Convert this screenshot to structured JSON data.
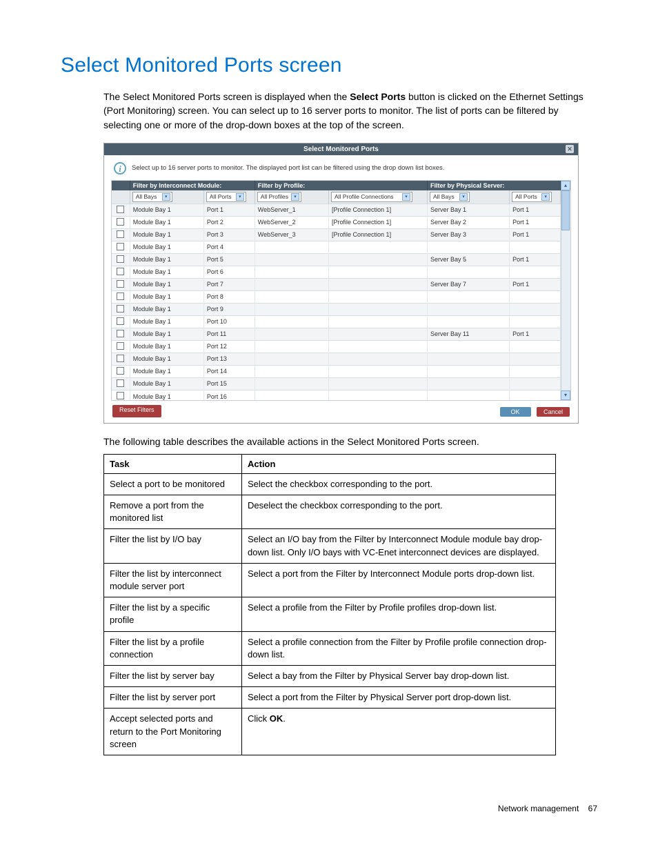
{
  "heading": "Select Monitored Ports screen",
  "intro_before": "The Select Monitored Ports screen is displayed when the ",
  "intro_bold": "Select Ports",
  "intro_after": " button is clicked on the Ethernet Settings (Port Monitoring) screen. You can select up to 16 server ports to monitor. The list of ports can be filtered by selecting one or more of the drop-down boxes at the top of the screen.",
  "dialog": {
    "title": "Select Monitored Ports",
    "info": "Select up to 16 server ports to monitor. The displayed port list can be filtered using the drop down list boxes.",
    "group_headers": {
      "interconnect": "Filter by Interconnect Module:",
      "profile": "Filter by Profile:",
      "server": "Filter by Physical Server:"
    },
    "filters": {
      "bays": "All Bays",
      "ports": "All Ports",
      "profiles": "All Profiles",
      "profile_conn": "All Profile Connections",
      "srv_bays": "All Bays",
      "srv_ports": "All Ports"
    },
    "rows": [
      {
        "module": "Module Bay 1",
        "port": "Port 1",
        "profile": "WebServer_1",
        "conn": "[Profile Connection 1]",
        "srv_bay": "Server Bay 1",
        "srv_port": "Port 1"
      },
      {
        "module": "Module Bay 1",
        "port": "Port 2",
        "profile": "WebServer_2",
        "conn": "[Profile Connection 1]",
        "srv_bay": "Server Bay 2",
        "srv_port": "Port 1"
      },
      {
        "module": "Module Bay 1",
        "port": "Port 3",
        "profile": "WebServer_3",
        "conn": "[Profile Connection 1]",
        "srv_bay": "Server Bay 3",
        "srv_port": "Port 1"
      },
      {
        "module": "Module Bay 1",
        "port": "Port 4",
        "profile": "",
        "conn": "",
        "srv_bay": "",
        "srv_port": ""
      },
      {
        "module": "Module Bay 1",
        "port": "Port 5",
        "profile": "",
        "conn": "",
        "srv_bay": "Server Bay 5",
        "srv_port": "Port 1"
      },
      {
        "module": "Module Bay 1",
        "port": "Port 6",
        "profile": "",
        "conn": "",
        "srv_bay": "",
        "srv_port": ""
      },
      {
        "module": "Module Bay 1",
        "port": "Port 7",
        "profile": "",
        "conn": "",
        "srv_bay": "Server Bay 7",
        "srv_port": "Port 1"
      },
      {
        "module": "Module Bay 1",
        "port": "Port 8",
        "profile": "",
        "conn": "",
        "srv_bay": "",
        "srv_port": ""
      },
      {
        "module": "Module Bay 1",
        "port": "Port 9",
        "profile": "",
        "conn": "",
        "srv_bay": "",
        "srv_port": ""
      },
      {
        "module": "Module Bay 1",
        "port": "Port 10",
        "profile": "",
        "conn": "",
        "srv_bay": "",
        "srv_port": ""
      },
      {
        "module": "Module Bay 1",
        "port": "Port 11",
        "profile": "",
        "conn": "",
        "srv_bay": "Server Bay 11",
        "srv_port": "Port 1"
      },
      {
        "module": "Module Bay 1",
        "port": "Port 12",
        "profile": "",
        "conn": "",
        "srv_bay": "",
        "srv_port": ""
      },
      {
        "module": "Module Bay 1",
        "port": "Port 13",
        "profile": "",
        "conn": "",
        "srv_bay": "",
        "srv_port": ""
      },
      {
        "module": "Module Bay 1",
        "port": "Port 14",
        "profile": "",
        "conn": "",
        "srv_bay": "",
        "srv_port": ""
      },
      {
        "module": "Module Bay 1",
        "port": "Port 15",
        "profile": "",
        "conn": "",
        "srv_bay": "",
        "srv_port": ""
      },
      {
        "module": "Module Bay 1",
        "port": "Port 16",
        "profile": "",
        "conn": "",
        "srv_bay": "",
        "srv_port": ""
      }
    ],
    "buttons": {
      "reset": "Reset Filters",
      "ok": "OK",
      "cancel": "Cancel"
    }
  },
  "table_intro": "The following table describes the available actions in the Select Monitored Ports screen.",
  "actions_table": {
    "headers": {
      "task": "Task",
      "action": "Action"
    },
    "rows": [
      {
        "task": "Select a port to be monitored",
        "action": "Select the checkbox corresponding to the port."
      },
      {
        "task": "Remove a port from the monitored list",
        "action": "Deselect the checkbox corresponding to the port."
      },
      {
        "task": "Filter the list by I/O bay",
        "action": "Select an I/O bay from the Filter by Interconnect Module module bay drop-down list. Only I/O bays with VC-Enet interconnect devices are displayed."
      },
      {
        "task": "Filter the list by interconnect module server port",
        "action": "Select a port from the Filter by Interconnect Module ports drop-down list."
      },
      {
        "task": "Filter the list by a specific profile",
        "action": "Select a profile from the Filter by Profile profiles drop-down list."
      },
      {
        "task": "Filter the list by a profile connection",
        "action": "Select a profile connection from the Filter by Profile profile connection drop-down list."
      },
      {
        "task": "Filter the list by server bay",
        "action": "Select a bay from the Filter by Physical Server bay drop-down list."
      },
      {
        "task": "Filter the list by server port",
        "action": "Select a port from the Filter by Physical Server port drop-down list."
      },
      {
        "task": "Accept selected ports and return to the Port Monitoring screen",
        "action_pre": "Click ",
        "action_bold": "OK",
        "action_post": "."
      }
    ]
  },
  "footer": {
    "section": "Network management",
    "page": "67"
  }
}
